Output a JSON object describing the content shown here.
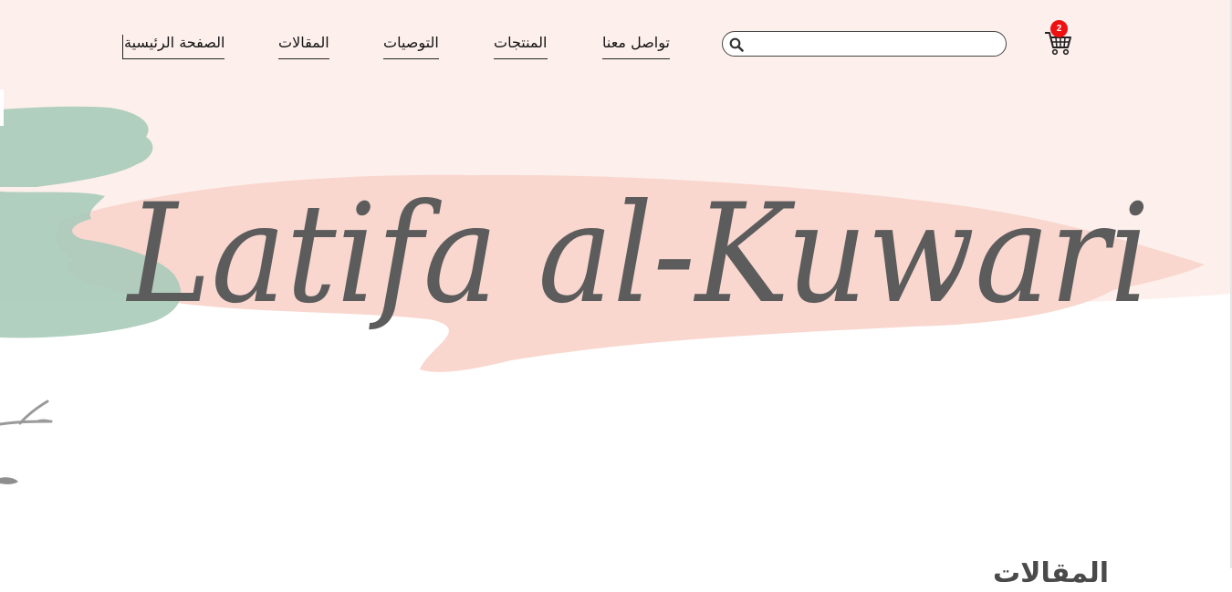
{
  "nav": {
    "items": [
      {
        "label": "الصفحة الرئيسية"
      },
      {
        "label": "المقالات"
      },
      {
        "label": "التوصيات"
      },
      {
        "label": "المنتجات"
      },
      {
        "label": "تواصل معنا"
      }
    ],
    "search": {
      "placeholder": "",
      "value": ""
    },
    "cart": {
      "count": "2",
      "icon": "cart-icon"
    }
  },
  "hero": {
    "logo_text": "Latifa al-Kuwari"
  },
  "section": {
    "title": "المقالات"
  },
  "colors": {
    "top_band": "#fdf0ec",
    "pink_stroke": "#f9d7cf",
    "green_stroke": "#a9cbb9",
    "logo_text": "#5c5c5c",
    "badge": "#ee1111"
  }
}
